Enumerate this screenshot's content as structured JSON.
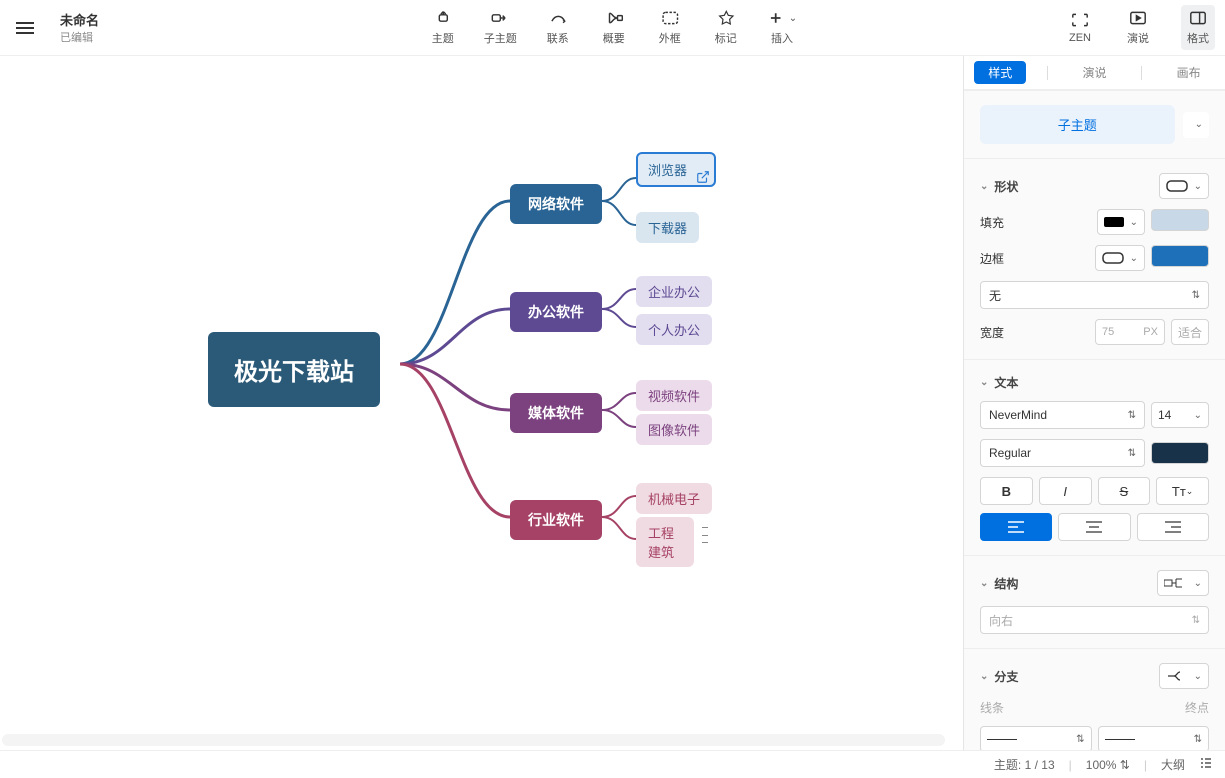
{
  "header": {
    "title": "未命名",
    "subtitle": "已编辑",
    "center_buttons": [
      {
        "label": "主题",
        "icon": "topic"
      },
      {
        "label": "子主题",
        "icon": "subtopic"
      },
      {
        "label": "联系",
        "icon": "relation"
      },
      {
        "label": "概要",
        "icon": "summary"
      },
      {
        "label": "外框",
        "icon": "boundary"
      },
      {
        "label": "标记",
        "icon": "marker"
      },
      {
        "label": "插入",
        "icon": "insert"
      }
    ],
    "right_buttons": [
      {
        "label": "ZEN",
        "icon": "zen"
      },
      {
        "label": "演说",
        "icon": "present"
      },
      {
        "label": "格式",
        "icon": "format",
        "active": true
      }
    ]
  },
  "mindmap": {
    "root": "极光下载站",
    "branches": [
      {
        "label": "网络软件",
        "children": [
          "浏览器",
          "下载器"
        ]
      },
      {
        "label": "办公软件",
        "children": [
          "企业办公",
          "个人办公"
        ]
      },
      {
        "label": "媒体软件",
        "children": [
          "视频软件",
          "图像软件"
        ]
      },
      {
        "label": "行业软件",
        "children": [
          "机械电子",
          "工程建筑"
        ]
      }
    ]
  },
  "panel": {
    "tabs": [
      "样式",
      "演说",
      "画布"
    ],
    "topic_type": "子主题",
    "shape": {
      "title": "形状",
      "fill": "填充",
      "border": "边框",
      "none": "无",
      "width": "宽度",
      "width_val": "75",
      "width_unit": "PX",
      "fit": "适合"
    },
    "text": {
      "title": "文本",
      "font": "NeverMind",
      "size": "14",
      "weight": "Regular"
    },
    "structure": {
      "title": "结构",
      "direction": "向右"
    },
    "branch": {
      "title": "分支",
      "line": "线条",
      "end": "终点"
    }
  },
  "status": {
    "topic_label": "主题:",
    "topic_count": "1 / 13",
    "zoom": "100%",
    "outline": "大纲"
  }
}
